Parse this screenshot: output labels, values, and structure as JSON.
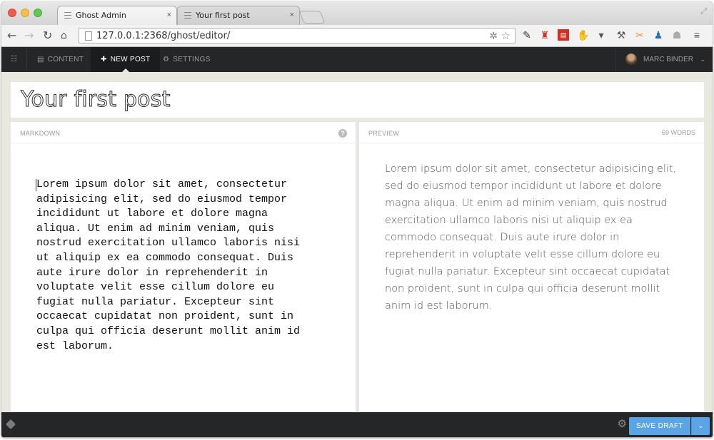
{
  "browser": {
    "tabs": [
      {
        "title": "Ghost Admin",
        "active": true
      },
      {
        "title": "Your first post",
        "active": false
      }
    ],
    "close_glyph": "×",
    "url": "127.0.0.1:2368/ghost/editor/"
  },
  "ghost_nav": {
    "items": [
      {
        "label": "Content",
        "icon": "content-icon"
      },
      {
        "label": "New Post",
        "icon": "plus-icon",
        "active": true
      },
      {
        "label": "Settings",
        "icon": "gear-icon"
      }
    ],
    "user": {
      "name": "Marc Binder"
    }
  },
  "editor": {
    "post_title": "Your first post",
    "markdown_label": "Markdown",
    "preview_label": "Preview",
    "word_count": "69 words",
    "help_glyph": "?",
    "markdown_text": "Lorem ipsum dolor sit amet, consectetur\nadipisicing elit, sed do eiusmod tempor\nincididunt ut labore et dolore magna\naliqua. Ut enim ad minim veniam, quis\nnostrud exercitation ullamco laboris nisi\nut aliquip ex ea commodo consequat. Duis\naute irure dolor in reprehenderit in\nvoluptate velit esse cillum dolore eu\nfugiat nulla pariatur. Excepteur sint\noccaecat cupidatat non proident, sunt in\nculpa qui officia deserunt mollit anim id\nest laborum.",
    "preview_text": "Lorem ipsum dolor sit amet, consectetur adipisicing elit, sed do eiusmod tempor incididunt ut labore et dolore magna aliqua. Ut enim ad minim veniam, quis nostrud exercitation ullamco laboris nisi ut aliquip ex ea commodo consequat. Duis aute irure dolor in reprehenderit in voluptate velit esse cillum dolore eu fugiat nulla pariatur. Excepteur sint occaecat cupidatat non proident, sunt in culpa qui officia deserunt mollit anim id est laborum."
  },
  "footer": {
    "save_label": "Save Draft"
  },
  "colors": {
    "nav_bg": "#242628",
    "accent": "#5ba4e5",
    "editor_bg": "#e8e8e0"
  }
}
